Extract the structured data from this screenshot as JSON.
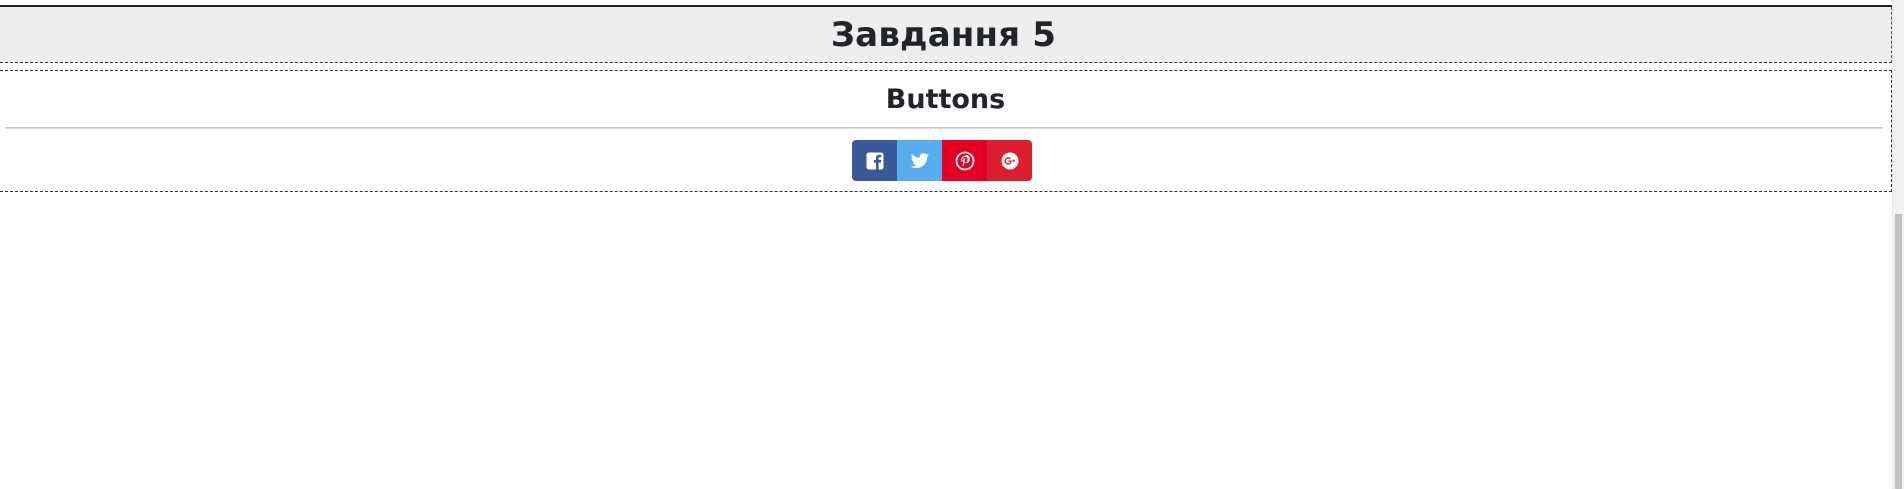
{
  "header": {
    "title": "Завдання 5"
  },
  "section": {
    "title": "Buttons"
  },
  "social_buttons": [
    {
      "network": "Facebook",
      "icon": "facebook-icon",
      "color": "#3b5998"
    },
    {
      "network": "Twitter",
      "icon": "twitter-icon",
      "color": "#55acee"
    },
    {
      "network": "Pinterest",
      "icon": "pinterest-icon",
      "color": "#e60023"
    },
    {
      "network": "Google Plus",
      "icon": "google-plus-icon",
      "color": "#dc1f2e"
    }
  ],
  "colors": {
    "header_background": "#eeeeee",
    "text": "#212529",
    "page_background": "#ffffff"
  }
}
